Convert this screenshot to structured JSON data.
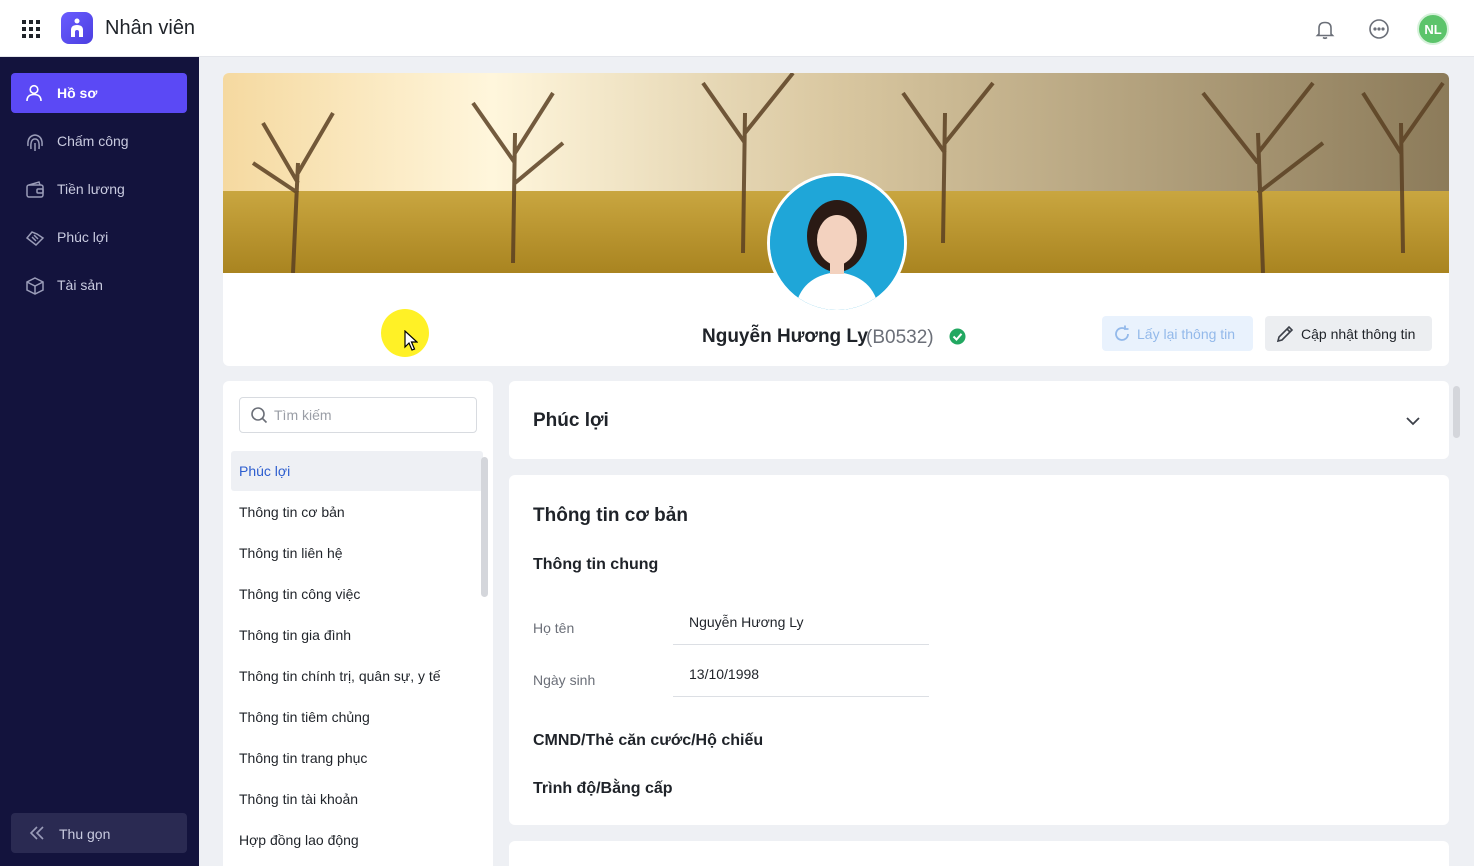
{
  "topbar": {
    "app_title": "Nhân viên",
    "user_initials": "NL",
    "icons": [
      "apps-grid-icon",
      "bell-icon",
      "more-icon"
    ]
  },
  "sidebar": {
    "items": [
      {
        "label": "Hồ sơ",
        "icon": "user-icon",
        "active": true
      },
      {
        "label": "Chấm công",
        "icon": "fingerprint-icon",
        "active": false
      },
      {
        "label": "Tiền lương",
        "icon": "wallet-icon",
        "active": false
      },
      {
        "label": "Phúc lợi",
        "icon": "handshake-icon",
        "active": false
      },
      {
        "label": "Tài sản",
        "icon": "box-icon",
        "active": false
      }
    ],
    "collapse_label": "Thu gọn"
  },
  "profile": {
    "name": "Nguyễn Hương Ly",
    "code": "(B0532)",
    "refresh_label": "Lấy lại thông tin",
    "update_label": "Cập nhật thông tin"
  },
  "section_nav": {
    "search_placeholder": "Tìm kiếm",
    "items": [
      "Phúc lợi",
      "Thông tin cơ bản",
      "Thông tin liên hệ",
      "Thông tin công việc",
      "Thông tin gia đình",
      "Thông tin chính trị, quân sự, y tế",
      "Thông tin tiêm chủng",
      "Thông tin trang phục",
      "Thông tin tài khoản",
      "Hợp đồng lao động"
    ]
  },
  "main": {
    "benefit_title": "Phúc lợi",
    "basic_title": "Thông tin cơ bản",
    "general_title": "Thông tin chung",
    "fields": [
      {
        "label": "Họ tên",
        "value": "Nguyễn Hương Ly"
      },
      {
        "label": "Ngày sinh",
        "value": "13/10/1998"
      }
    ],
    "id_title": "CMND/Thẻ căn cước/Hộ chiếu",
    "education_title": "Trình độ/Bằng cấp"
  },
  "colors": {
    "sidebar_bg": "#13133d",
    "accent": "#5b49f5",
    "verified": "#22a861",
    "avatar_bg": "#5cc46b"
  }
}
